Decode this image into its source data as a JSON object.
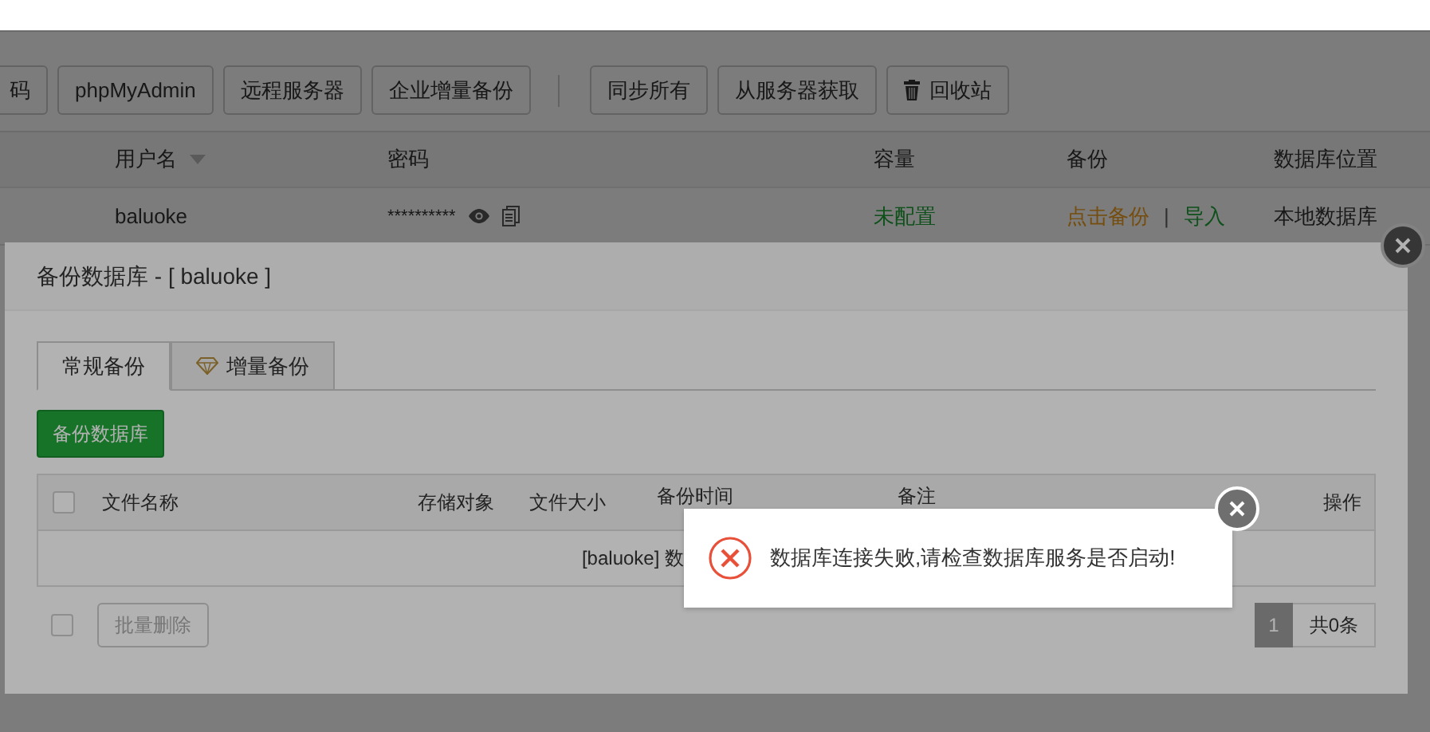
{
  "toolbar": {
    "groups": [
      [
        {
          "label": "码",
          "kind": "plain"
        },
        {
          "label": "phpMyAdmin",
          "kind": "plain"
        },
        {
          "label": "远程服务器",
          "kind": "plain"
        },
        {
          "label": "企业增量备份",
          "kind": "plain"
        }
      ],
      [
        {
          "label": "同步所有",
          "kind": "plain"
        },
        {
          "label": "从服务器获取",
          "kind": "plain"
        },
        {
          "label": "回收站",
          "kind": "trash"
        }
      ]
    ]
  },
  "table": {
    "columns": [
      {
        "label": "用户名",
        "sorted": true
      },
      {
        "label": "密码",
        "sorted": false
      },
      {
        "label": "容量",
        "sorted": false
      },
      {
        "label": "备份",
        "sorted": false
      },
      {
        "label": "数据库位置",
        "sorted": false
      }
    ],
    "rows": [
      {
        "username": "baluoke",
        "password": "**********",
        "capacity": "未配置",
        "backup": "点击备份",
        "separator": "|",
        "import": "导入",
        "location": "本地数据库"
      }
    ]
  },
  "dialog": {
    "title": "备份数据库 - [ baluoke ]",
    "tabs": [
      {
        "label": "常规备份",
        "selected": true,
        "kind": "plain"
      },
      {
        "label": "增量备份",
        "selected": false,
        "kind": "premium"
      }
    ],
    "primary_button": "备份数据库",
    "table": {
      "select_all": {
        "checked": false
      },
      "columns": [
        "文件名称",
        "存储对象",
        "文件大小",
        "备份时间",
        "备注",
        "操作"
      ],
      "empty_text": "[baluoke] 数"
    },
    "footer": {
      "select_all": {
        "checked": false
      },
      "batch_button": {
        "label": "批量删除",
        "disabled": true
      },
      "pages": [
        {
          "label": "1",
          "selected": true
        }
      ],
      "total": "共0条"
    }
  },
  "toast": {
    "kind": "error",
    "message": "数据库连接失败,请检查数据库服务是否启动!"
  }
}
